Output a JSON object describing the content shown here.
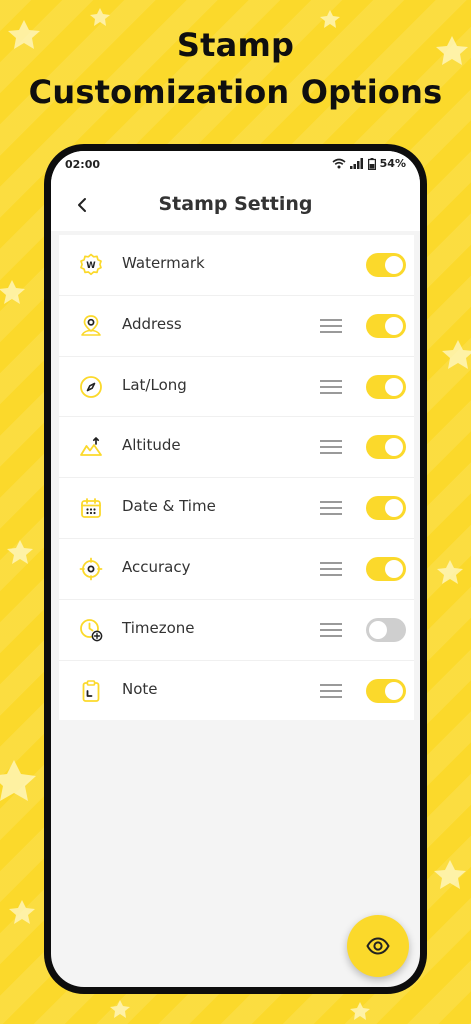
{
  "headline": {
    "line1": "Stamp",
    "line2": "Customization Options"
  },
  "status_bar": {
    "time": "02:00",
    "battery": "54%"
  },
  "app_bar": {
    "title": "Stamp Setting"
  },
  "items": [
    {
      "label": "Watermark",
      "icon": "watermark-badge-icon",
      "badge_letter": "W",
      "draggable": false,
      "enabled": true
    },
    {
      "label": "Address",
      "icon": "address-pin-icon",
      "draggable": true,
      "enabled": true
    },
    {
      "label": "Lat/Long",
      "icon": "compass-icon",
      "draggable": true,
      "enabled": true
    },
    {
      "label": "Altitude",
      "icon": "mountain-icon",
      "draggable": true,
      "enabled": true
    },
    {
      "label": "Date & Time",
      "icon": "calendar-icon",
      "draggable": true,
      "enabled": true
    },
    {
      "label": "Accuracy",
      "icon": "crosshair-icon",
      "draggable": true,
      "enabled": true
    },
    {
      "label": "Timezone",
      "icon": "timezone-clock-icon",
      "draggable": true,
      "enabled": false
    },
    {
      "label": "Note",
      "icon": "clipboard-note-icon",
      "draggable": true,
      "enabled": true
    }
  ],
  "colors": {
    "accent": "#FBD92B",
    "text": "#333333",
    "toggle_off": "#cfcfcf"
  }
}
